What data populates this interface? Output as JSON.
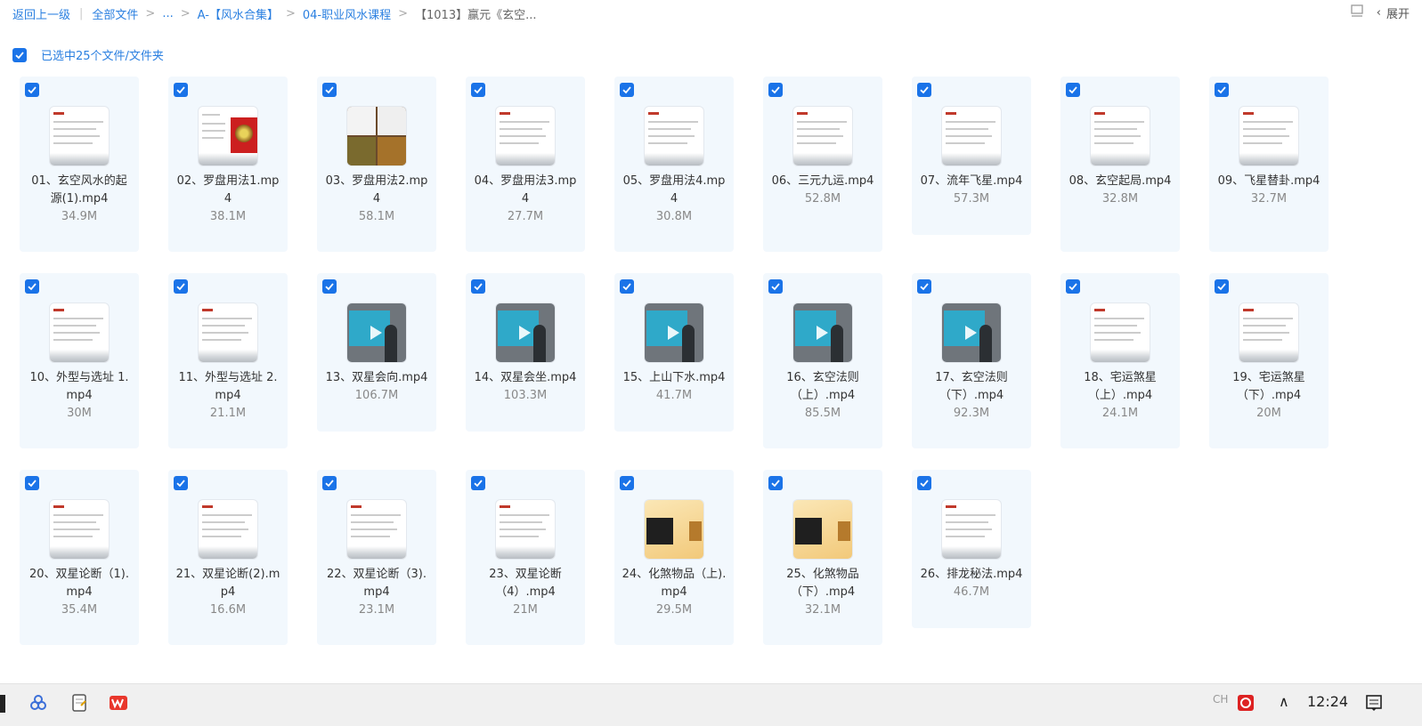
{
  "breadcrumb": {
    "back": "返回上一级",
    "all_files": "全部文件",
    "ellipsis": "...",
    "a_collection": "A-【风水合集】",
    "course": "04-职业风水课程",
    "current": "【1013】赢元《玄空..."
  },
  "toolbar": {
    "expand_label": "展开"
  },
  "selection": {
    "label": "已选中25个文件/文件夹"
  },
  "files": [
    {
      "name": "01、玄空风水的起源(1).mp4",
      "size": "34.9M",
      "thumb": "doc"
    },
    {
      "name": "02、罗盘用法1.mp4",
      "size": "38.1M",
      "thumb": "doc-red"
    },
    {
      "name": "03、罗盘用法2.mp4",
      "size": "58.1M",
      "thumb": "photo"
    },
    {
      "name": "04、罗盘用法3.mp4",
      "size": "27.7M",
      "thumb": "doc"
    },
    {
      "name": "05、罗盘用法4.mp4",
      "size": "30.8M",
      "thumb": "doc"
    },
    {
      "name": "06、三元九运.mp4",
      "size": "52.8M",
      "thumb": "doc"
    },
    {
      "name": "07、流年飞星.mp4",
      "size": "57.3M",
      "thumb": "doc"
    },
    {
      "name": "08、玄空起局.mp4",
      "size": "32.8M",
      "thumb": "doc"
    },
    {
      "name": "09、飞星替卦.mp4",
      "size": "32.7M",
      "thumb": "doc"
    },
    {
      "name": "10、外型与选址 1.mp4",
      "size": "30M",
      "thumb": "doc"
    },
    {
      "name": "11、外型与选址 2.mp4",
      "size": "21.1M",
      "thumb": "doc"
    },
    {
      "name": "13、双星会向.mp4",
      "size": "106.7M",
      "thumb": "video"
    },
    {
      "name": "14、双星会坐.mp4",
      "size": "103.3M",
      "thumb": "video"
    },
    {
      "name": "15、上山下水.mp4",
      "size": "41.7M",
      "thumb": "video"
    },
    {
      "name": "16、玄空法则（上）.mp4",
      "size": "85.5M",
      "thumb": "video"
    },
    {
      "name": "17、玄空法则（下）.mp4",
      "size": "92.3M",
      "thumb": "video"
    },
    {
      "name": "18、宅运煞星（上）.mp4",
      "size": "24.1M",
      "thumb": "doc"
    },
    {
      "name": "19、宅运煞星（下）.mp4",
      "size": "20M",
      "thumb": "doc"
    },
    {
      "name": "20、双星论断（1).mp4",
      "size": "35.4M",
      "thumb": "doc"
    },
    {
      "name": "21、双星论断(2).mp4",
      "size": "16.6M",
      "thumb": "doc"
    },
    {
      "name": "22、双星论断（3).mp4",
      "size": "23.1M",
      "thumb": "doc"
    },
    {
      "name": "23、双星论断（4）.mp4",
      "size": "21M",
      "thumb": "doc"
    },
    {
      "name": "24、化煞物品（上).mp4",
      "size": "29.5M",
      "thumb": "gold"
    },
    {
      "name": "25、化煞物品（下）.mp4",
      "size": "32.1M",
      "thumb": "gold"
    },
    {
      "name": "26、排龙秘法.mp4",
      "size": "46.7M",
      "thumb": "doc"
    }
  ],
  "taskbar": {
    "clock": "12:24"
  },
  "colors": {
    "accent": "#1a73e8",
    "link": "#2a7fe0",
    "tile_bg": "#f2f8fd"
  }
}
